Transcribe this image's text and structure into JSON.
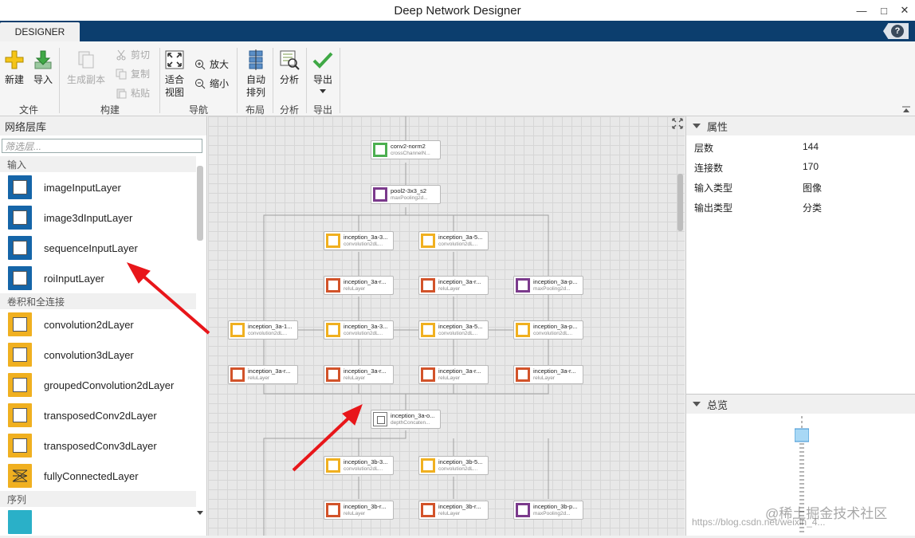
{
  "window": {
    "title": "Deep Network Designer",
    "controls": [
      "—",
      "□",
      "✕"
    ]
  },
  "tabs": {
    "active": "DESIGNER",
    "help": "?"
  },
  "ribbon": {
    "file": {
      "group": "文件",
      "new": "新建",
      "import": "导入"
    },
    "build": {
      "group": "构建",
      "duplicate": "生成副本",
      "cut": "剪切",
      "copy": "复制",
      "paste": "粘贴"
    },
    "navigate": {
      "group": "导航",
      "fit_line1": "适合",
      "fit_line2": "视图",
      "zoom_in": "放大",
      "zoom_out": "缩小"
    },
    "layout": {
      "group": "布局",
      "auto_line1": "自动",
      "auto_line2": "排列"
    },
    "analysis": {
      "group": "分析",
      "analyze": "分析"
    },
    "export": {
      "group": "导出",
      "export": "导出"
    }
  },
  "library": {
    "title": "网络层库",
    "search_placeholder": "筛选层...",
    "categories": [
      {
        "name": "输入",
        "items": [
          "imageInputLayer",
          "image3dInputLayer",
          "sequenceInputLayer",
          "roiInputLayer"
        ]
      },
      {
        "name": "卷积和全连接",
        "items": [
          "convolution2dLayer",
          "convolution3dLayer",
          "groupedConvolution2dLayer",
          "transposedConv2dLayer",
          "transposedConv3dLayer",
          "fullyConnectedLayer"
        ]
      },
      {
        "name": "序列",
        "items": []
      }
    ]
  },
  "network": {
    "nodes": [
      {
        "name": "conv2-norm2",
        "type": "crossChannelN...",
        "color": "green"
      },
      {
        "name": "pool2-3x3_s2",
        "type": "maxPooling2d...",
        "color": "purple"
      },
      {
        "name": "inception_3a-3...",
        "type": "convolution2dL...",
        "color": "yellow"
      },
      {
        "name": "inception_3a-5...",
        "type": "convolution2dL...",
        "color": "yellow"
      },
      {
        "name": "inception_3a-r...",
        "type": "reluLayer",
        "color": "orange"
      },
      {
        "name": "inception_3a-r...",
        "type": "reluLayer",
        "color": "orange"
      },
      {
        "name": "inception_3a-p...",
        "type": "maxPooling2d...",
        "color": "purple"
      },
      {
        "name": "inception_3a-1...",
        "type": "convolution2dL...",
        "color": "yellow"
      },
      {
        "name": "inception_3a-3...",
        "type": "convolution2dL...",
        "color": "yellow"
      },
      {
        "name": "inception_3a-5...",
        "type": "convolution2dL...",
        "color": "yellow"
      },
      {
        "name": "inception_3a-p...",
        "type": "convolution2dL...",
        "color": "yellow"
      },
      {
        "name": "inception_3a-r...",
        "type": "reluLayer",
        "color": "orange"
      },
      {
        "name": "inception_3a-r...",
        "type": "reluLayer",
        "color": "orange"
      },
      {
        "name": "inception_3a-r...",
        "type": "reluLayer",
        "color": "orange"
      },
      {
        "name": "inception_3a-r...",
        "type": "reluLayer",
        "color": "orange"
      },
      {
        "name": "inception_3a-o...",
        "type": "depthConcaten...",
        "color": "gray"
      },
      {
        "name": "inception_3b-3...",
        "type": "convolution2dL...",
        "color": "yellow"
      },
      {
        "name": "inception_3b-5...",
        "type": "convolution2dL...",
        "color": "yellow"
      },
      {
        "name": "inception_3b-r...",
        "type": "reluLayer",
        "color": "orange"
      },
      {
        "name": "inception_3b-r...",
        "type": "reluLayer",
        "color": "orange"
      },
      {
        "name": "inception_3b-p...",
        "type": "maxPooling2d...",
        "color": "purple"
      }
    ]
  },
  "properties": {
    "title": "属性",
    "rows": [
      {
        "key": "层数",
        "value": "144"
      },
      {
        "key": "连接数",
        "value": "170"
      },
      {
        "key": "输入类型",
        "value": "图像"
      },
      {
        "key": "输出类型",
        "value": "分类"
      }
    ]
  },
  "overview": {
    "title": "总览"
  },
  "watermarks": {
    "brand": "@稀土掘金技术社区",
    "url": "https://blog.csdn.net/weixin_4..."
  },
  "colors": {
    "tabbar": "#0c3e6e",
    "annotation_arrow": "#e8161a",
    "selection": "#5fb3e8"
  }
}
